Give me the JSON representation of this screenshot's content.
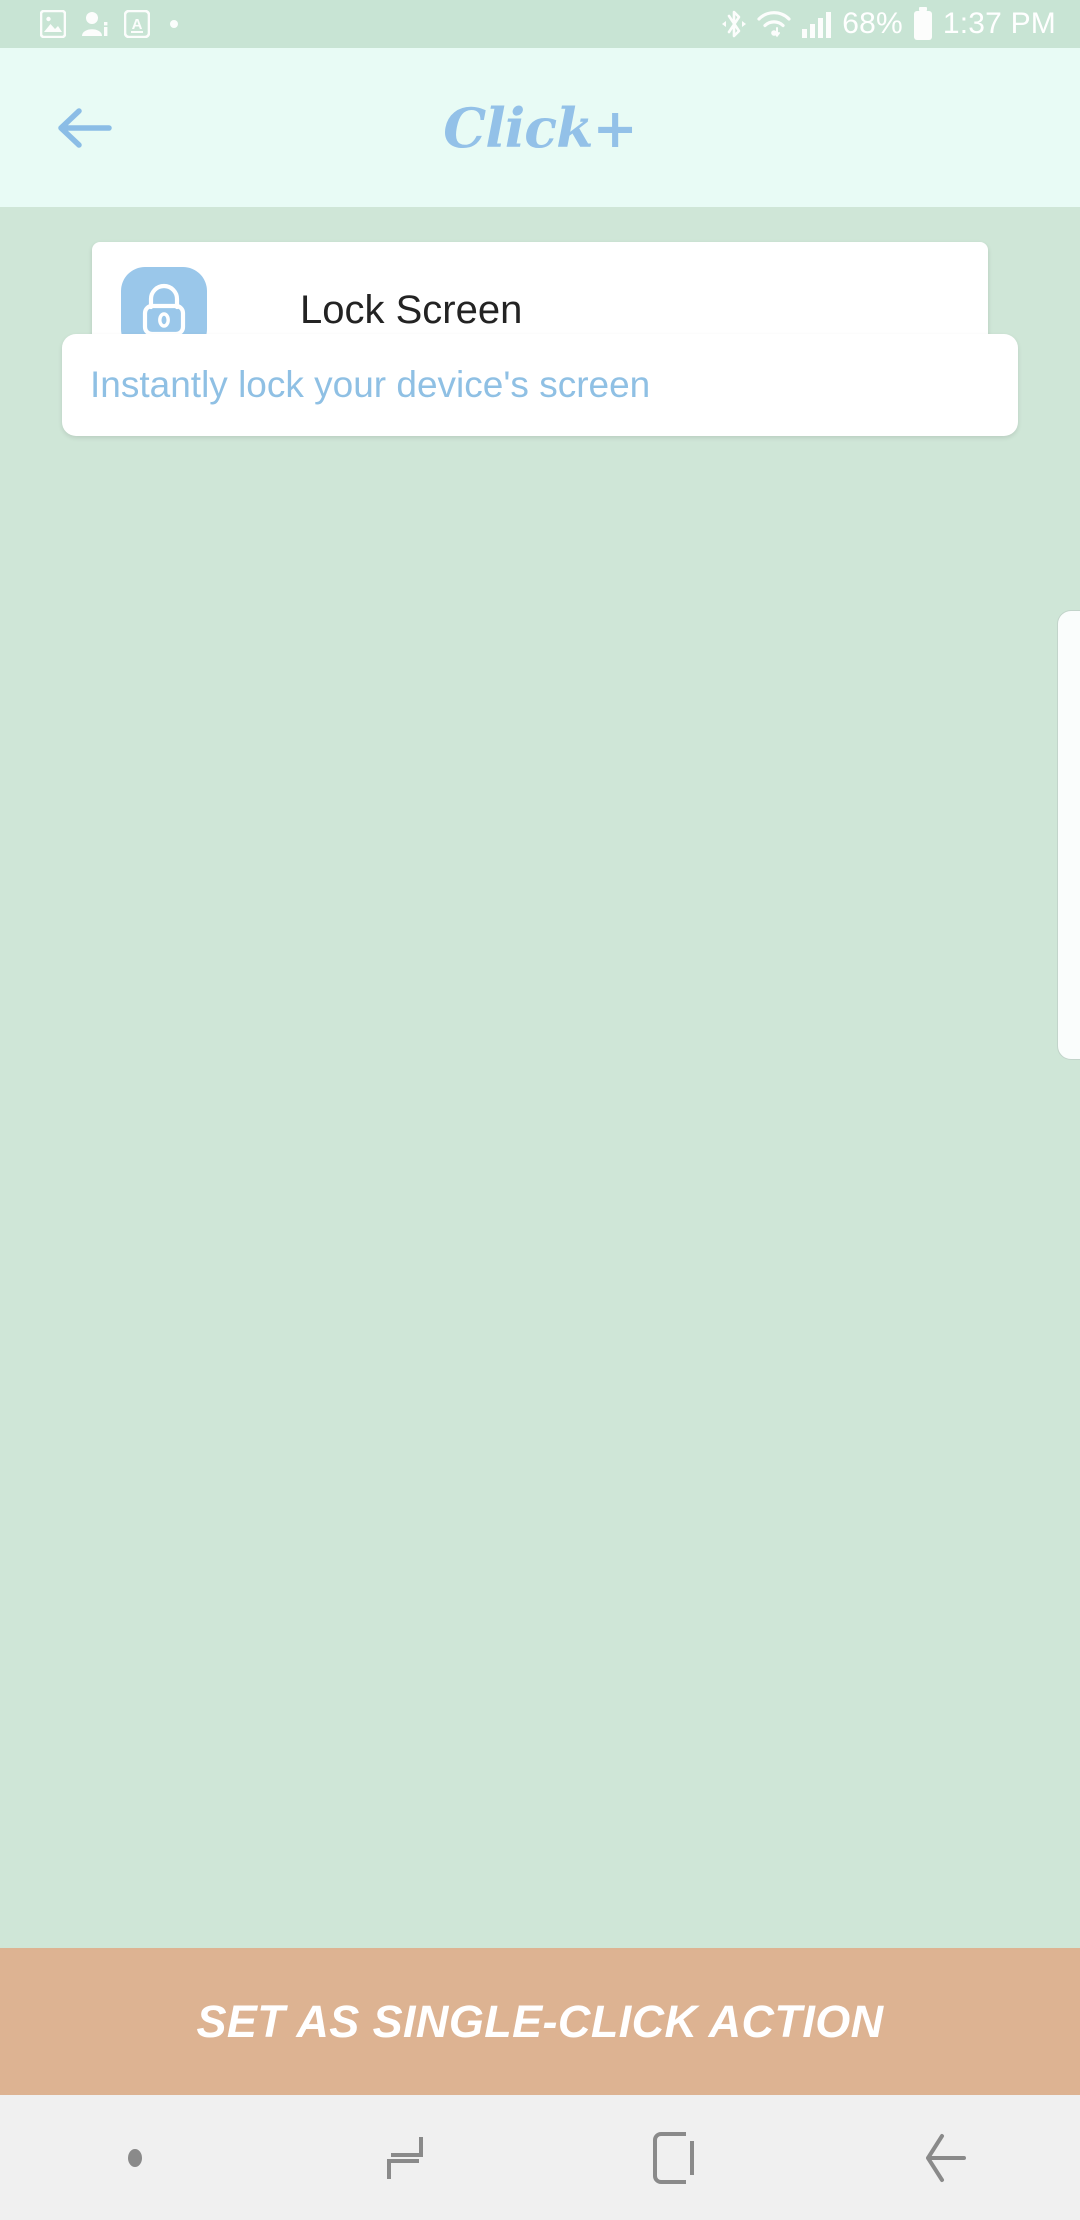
{
  "status_bar": {
    "left_icons": [
      {
        "name": "photo-icon",
        "label": "photo"
      },
      {
        "name": "contact-icon",
        "label": "contact info"
      },
      {
        "name": "a-badge-icon",
        "label": "A"
      },
      {
        "name": "dot-icon",
        "label": ""
      }
    ],
    "bluetooth_icon": "bluetooth",
    "wifi_icon": "wifi",
    "signal_icon": "cellular-signal",
    "battery_percent": "68%",
    "battery_icon": "battery",
    "time": "1:37 PM"
  },
  "app_bar": {
    "back_label": "Back",
    "title": "Click+"
  },
  "action": {
    "icon": "lock-icon",
    "title": "Lock Screen",
    "description": "Instantly lock your device's screen"
  },
  "cta": {
    "label": "SET AS SINGLE-CLICK ACTION"
  },
  "nav_bar": {
    "items": [
      {
        "name": "nav-dot",
        "label": ""
      },
      {
        "name": "recents-icon",
        "label": "Recents"
      },
      {
        "name": "home-icon",
        "label": "Home"
      },
      {
        "name": "back-icon",
        "label": "Back"
      }
    ]
  },
  "colors": {
    "page_background": "#cfe6d7",
    "status_bar_background": "#c8e4d4",
    "app_bar_background": "#e8fbf5",
    "accent_blue": "#93c1e8",
    "cta_background": "#ddb392",
    "nav_bar_background": "#f0f0f0",
    "card_background": "#ffffff",
    "title_text": "#232323"
  }
}
